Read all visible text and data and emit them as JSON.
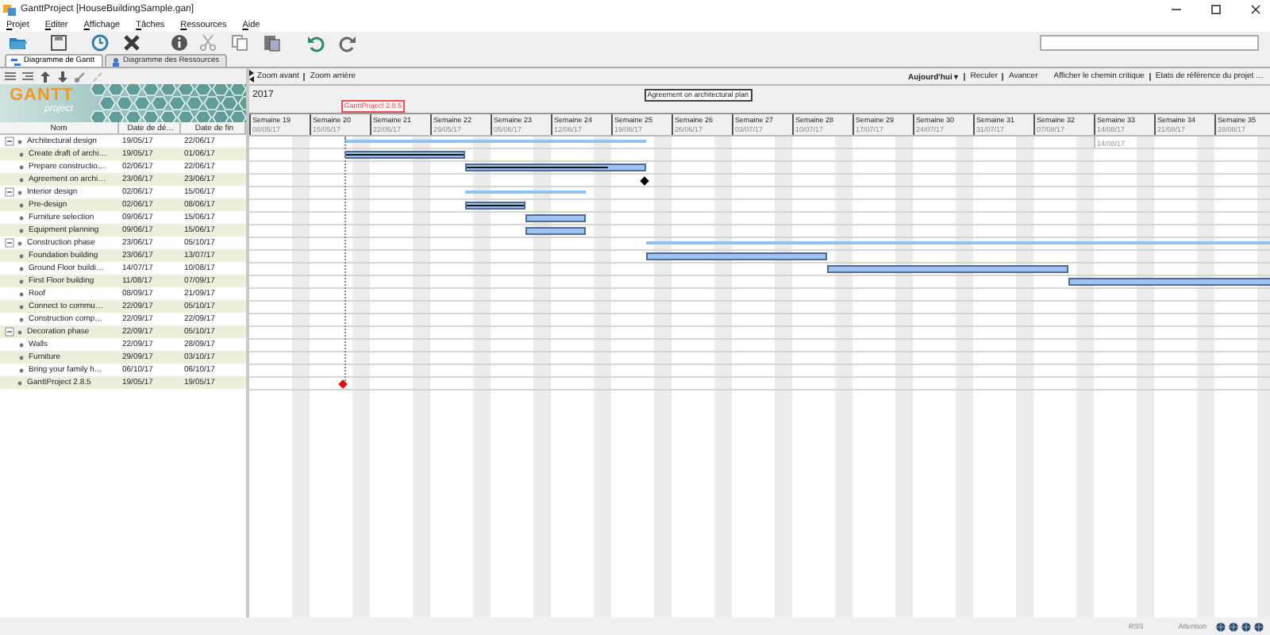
{
  "window": {
    "title": "GanttProject [HouseBuildingSample.gan]"
  },
  "menu": [
    "Projet",
    "Editer",
    "Affichage",
    "Tâches",
    "Ressources",
    "Aide"
  ],
  "tabs": [
    {
      "label": "Diagramme de Gantt",
      "selected": true
    },
    {
      "label": "Diagramme des Ressources",
      "selected": false
    }
  ],
  "logo": {
    "name": "GANTT",
    "tagline": "project"
  },
  "table": {
    "columns": [
      "Nom",
      "Date de dé…",
      "Date de fin"
    ],
    "rows": [
      {
        "name": "Architectural design",
        "start": "19/05/17",
        "end": "22/06/17",
        "expanded": true,
        "children": [
          {
            "name": "Create draft of archi…",
            "start": "19/05/17",
            "end": "01/06/17",
            "kind": "task",
            "level": 1
          },
          {
            "name": "Prepare constructio…",
            "start": "02/06/17",
            "end": "22/06/17",
            "kind": "task",
            "level": 0.8
          },
          {
            "name": "Agreement on archi…",
            "start": "23/06/17",
            "end": "23/06/17",
            "kind": "milestone",
            "timeline_label": "Agreement on architectural plan"
          }
        ]
      },
      {
        "name": "Interior design",
        "start": "02/06/17",
        "end": "15/06/17",
        "expanded": true,
        "children": [
          {
            "name": "Pre-design",
            "start": "02/06/17",
            "end": "08/06/17",
            "kind": "task",
            "level": 1
          },
          {
            "name": "Furniture selection",
            "start": "09/06/17",
            "end": "15/06/17",
            "kind": "task"
          },
          {
            "name": "Equipment planning",
            "start": "09/06/17",
            "end": "15/06/17",
            "kind": "task"
          }
        ]
      },
      {
        "name": "Construction phase",
        "start": "23/06/17",
        "end": "05/10/17",
        "expanded": true,
        "children": [
          {
            "name": "Foundation building",
            "start": "23/06/17",
            "end": "13/07/17",
            "kind": "task"
          },
          {
            "name": "Ground Floor buildi…",
            "start": "14/07/17",
            "end": "10/08/17",
            "kind": "task"
          },
          {
            "name": "First Floor building",
            "start": "11/08/17",
            "end": "07/09/17",
            "kind": "task"
          },
          {
            "name": "Roof",
            "start": "08/09/17",
            "end": "21/09/17",
            "kind": "task"
          },
          {
            "name": "Connect to commu…",
            "start": "22/09/17",
            "end": "05/10/17",
            "kind": "task"
          },
          {
            "name": "Construction comp…",
            "start": "22/09/17",
            "end": "22/09/17",
            "kind": "task"
          }
        ]
      },
      {
        "name": "Decoration phase",
        "start": "22/09/17",
        "end": "05/10/17",
        "expanded": true,
        "children": [
          {
            "name": "Walls",
            "start": "22/09/17",
            "end": "28/09/17",
            "kind": "task"
          },
          {
            "name": "Furniture",
            "start": "29/09/17",
            "end": "03/10/17",
            "kind": "task"
          },
          {
            "name": "Bring your family h…",
            "start": "06/10/17",
            "end": "06/10/17",
            "kind": "task"
          }
        ]
      },
      {
        "name": "GanttProject 2.8.5",
        "start": "19/05/17",
        "end": "19/05/17",
        "kind": "release",
        "timeline_label": "GanttProject 2.8.5"
      }
    ]
  },
  "chart": {
    "zoom": [
      "Zoom avant",
      "Zoom arrière"
    ],
    "today": "Aujourd'hui",
    "today_caret": "▾",
    "nav": [
      "Reculer",
      "Avancer"
    ],
    "links": [
      "Afficher le chemin critique",
      "Etats de référence du projet …"
    ],
    "year": "2017",
    "today_label": "14/08/17",
    "weeks": [
      {
        "label": "Semaine 19",
        "date": "08/05/17"
      },
      {
        "label": "Semaine 20",
        "date": "15/05/17"
      },
      {
        "label": "Semaine 21",
        "date": "22/05/17"
      },
      {
        "label": "Semaine 22",
        "date": "29/05/17"
      },
      {
        "label": "Semaine 23",
        "date": "05/06/17"
      },
      {
        "label": "Semaine 24",
        "date": "12/06/17"
      },
      {
        "label": "Semaine 25",
        "date": "19/06/17"
      },
      {
        "label": "Semaine 26",
        "date": "26/06/17"
      },
      {
        "label": "Semaine 27",
        "date": "03/07/17"
      },
      {
        "label": "Semaine 28",
        "date": "10/07/17"
      },
      {
        "label": "Semaine 29",
        "date": "17/07/17"
      },
      {
        "label": "Semaine 30",
        "date": "24/07/17"
      },
      {
        "label": "Semaine 31",
        "date": "31/07/17"
      },
      {
        "label": "Semaine 32",
        "date": "07/08/17"
      },
      {
        "label": "Semaine 33",
        "date": "14/08/17"
      },
      {
        "label": "Semaine 34",
        "date": "21/08/17"
      },
      {
        "label": "Semaine 35",
        "date": "28/08/17"
      }
    ]
  },
  "status_bar": [
    "RSS",
    "Attention"
  ]
}
